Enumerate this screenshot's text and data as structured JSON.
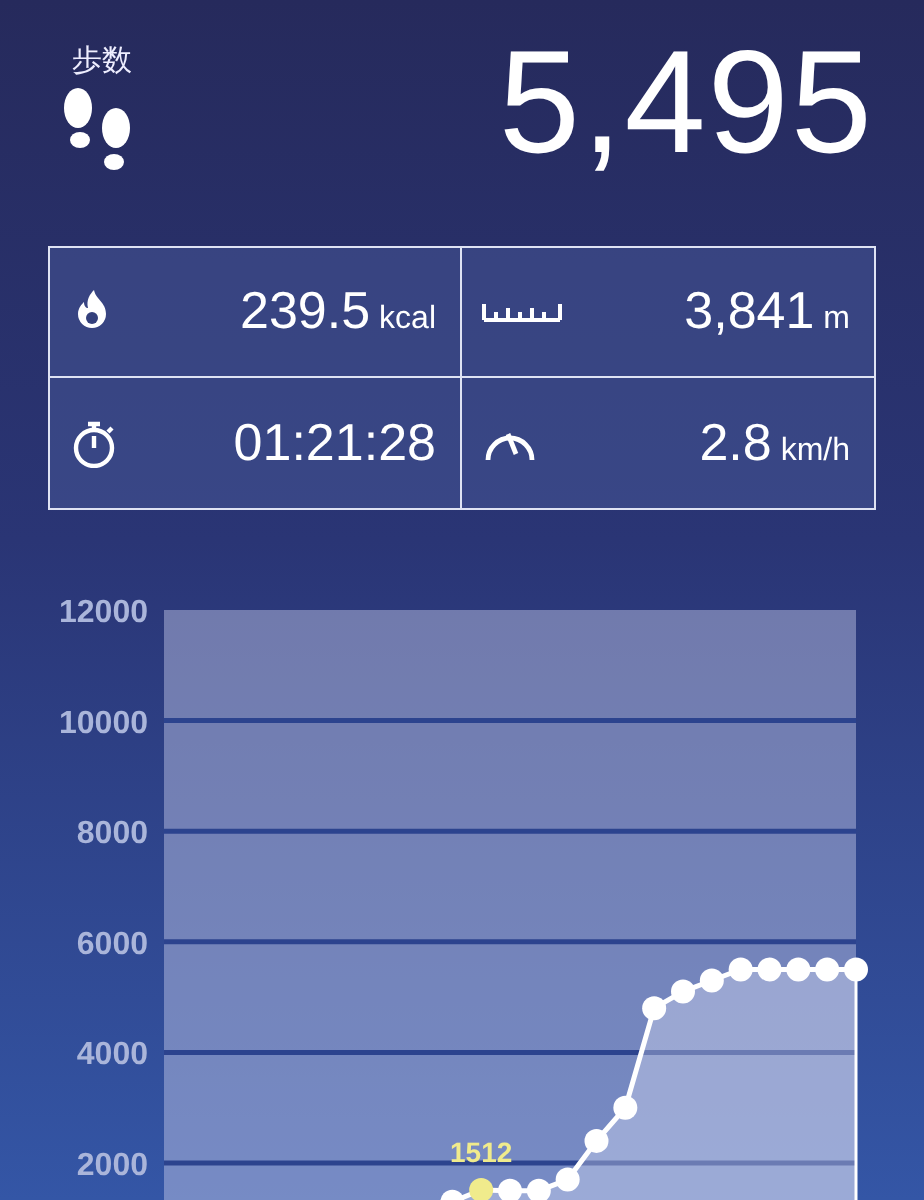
{
  "steps": {
    "label": "歩数",
    "value": "5,495"
  },
  "stats": [
    {
      "kind": "calories",
      "value": "239.5",
      "unit": "kcal"
    },
    {
      "kind": "distance",
      "value": "3,841",
      "unit": "m"
    },
    {
      "kind": "duration",
      "value": "01:21:28"
    },
    {
      "kind": "speed",
      "value": "2.8",
      "unit": "km/h"
    }
  ],
  "chart": {
    "chart_data": {
      "type": "area",
      "grid": true,
      "ylim": [
        0,
        12000
      ],
      "yticks": [
        2000,
        4000,
        6000,
        8000,
        10000,
        12000
      ],
      "series": [
        {
          "color": "#ffffff",
          "values": [
            null,
            null,
            null,
            null,
            null,
            null,
            null,
            null,
            null,
            null,
            1300,
            1512,
            1500,
            1500,
            1700,
            2400,
            3000,
            4800,
            5100,
            5300,
            5500,
            5500,
            5500,
            5500,
            5500
          ]
        }
      ],
      "annotations": [
        {
          "y": 1512,
          "text": "1512"
        }
      ]
    }
  }
}
